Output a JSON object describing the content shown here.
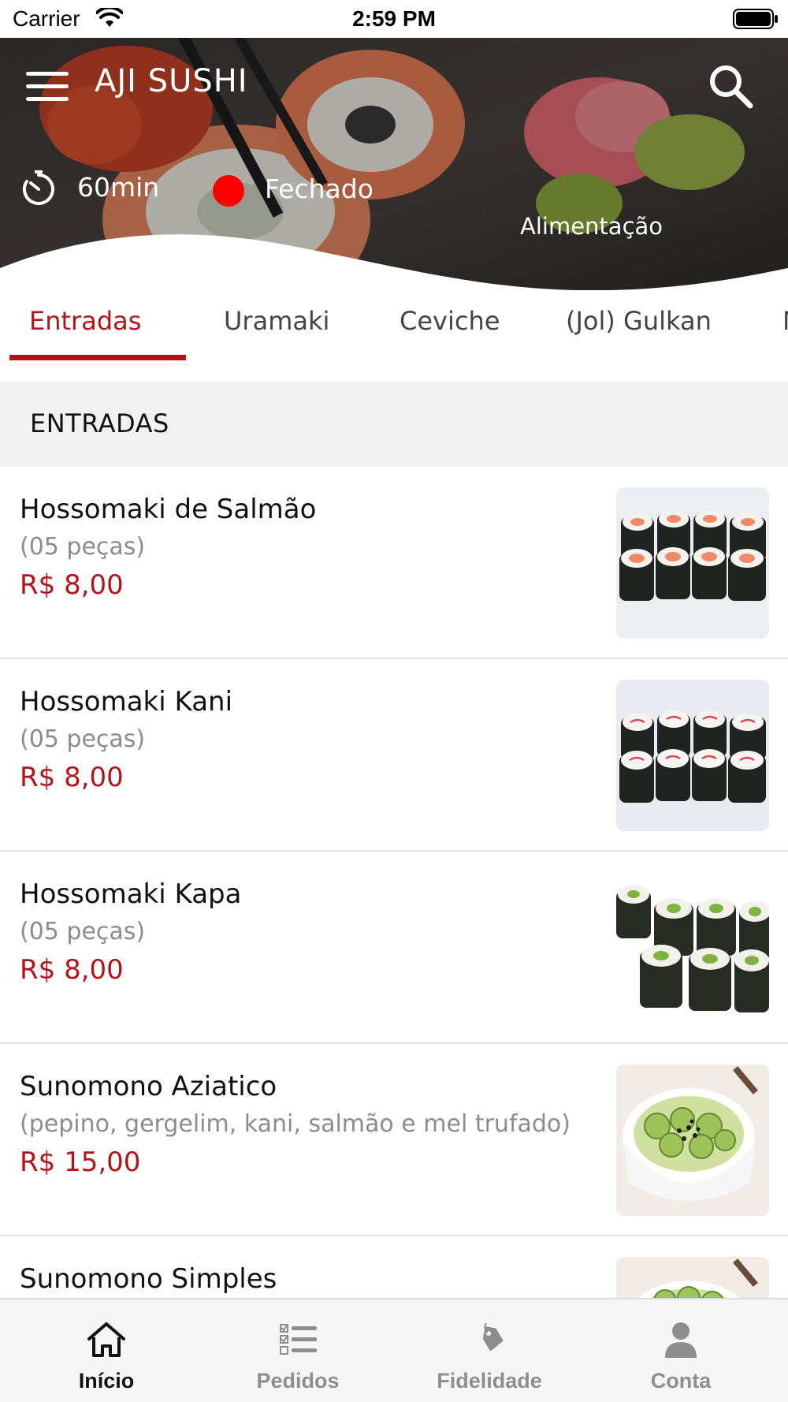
{
  "status_bar": {
    "carrier": "Carrier",
    "time": "2:59 PM"
  },
  "header": {
    "title": "AJI SUSHI",
    "delivery_time": "60min",
    "status": "Fechado",
    "status_color": "#ff0000",
    "category": "Alimentação"
  },
  "tabs": [
    {
      "label": "Entradas",
      "active": true
    },
    {
      "label": "Uramaki",
      "active": false
    },
    {
      "label": "Ceviche",
      "active": false
    },
    {
      "label": "(Jol) Gulkan",
      "active": false
    },
    {
      "label": "N",
      "active": false
    }
  ],
  "section": {
    "title": "ENTRADAS"
  },
  "items": [
    {
      "name": "Hossomaki de Salmão",
      "description": "(05 peças)",
      "price": "R$ 8,00",
      "image": "salmon-hossomaki-image"
    },
    {
      "name": "Hossomaki Kani",
      "description": "(05 peças)",
      "price": "R$ 8,00",
      "image": "kani-hossomaki-image"
    },
    {
      "name": "Hossomaki Kapa",
      "description": "(05 peças)",
      "price": "R$ 8,00",
      "image": "cucumber-hossomaki-image"
    },
    {
      "name": "Sunomono Aziatico",
      "description": "(pepino, gergelim, kani, salmão e mel trufado)",
      "price": "R$ 15,00",
      "image": "sunomono-bowl-image"
    },
    {
      "name": "Sunomono Simples",
      "description": "",
      "price": "",
      "image": "sunomono-bowl-image"
    }
  ],
  "tabbar": [
    {
      "label": "Início",
      "icon": "home-icon",
      "active": true
    },
    {
      "label": "Pedidos",
      "icon": "orders-list-icon",
      "active": false
    },
    {
      "label": "Fidelidade",
      "icon": "loyalty-tag-icon",
      "active": false
    },
    {
      "label": "Conta",
      "icon": "account-icon",
      "active": false
    }
  ],
  "colors": {
    "accent": "#b3131b",
    "section_bg": "#f2f2f2",
    "tabbar_bg": "#f6f6f6"
  }
}
